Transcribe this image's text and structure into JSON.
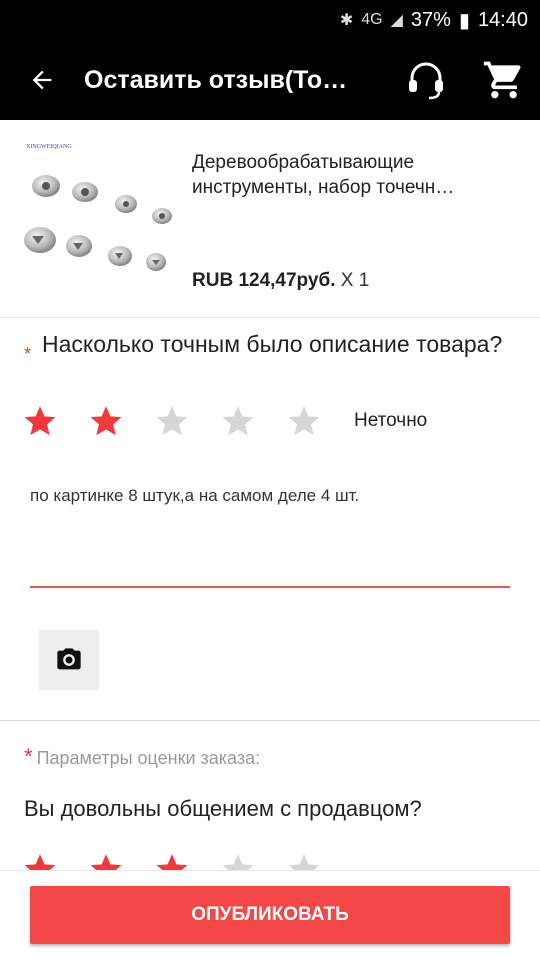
{
  "status": {
    "battery": "37%",
    "time": "14:40",
    "network": "4G"
  },
  "app_bar": {
    "title": "Оставить отзыв(То…"
  },
  "product": {
    "brand": "XINGWEIQIANG",
    "name": "Деревообрабатывающие инструменты, набор точечн…",
    "price": "RUB 124,47руб.",
    "quantity": "X 1"
  },
  "question1": {
    "required_mark": "*",
    "text": "Насколько точным было описание товара?",
    "rating": 2,
    "max_rating": 5,
    "rating_label": "Неточно"
  },
  "review": {
    "text": "по картинке 8 штук,а на самом деле 4 шт."
  },
  "params": {
    "required_mark": "*",
    "label": "Параметры оценки заказа:"
  },
  "question2": {
    "text": "Вы довольны общением с продавцом?",
    "rating": 3,
    "max_rating": 5
  },
  "publish_button": {
    "label": "ОПУБЛИКОВАТЬ"
  },
  "colors": {
    "accent": "#f44848",
    "star_active": "#ee3a3e",
    "star_inactive": "#d6d6d6"
  }
}
